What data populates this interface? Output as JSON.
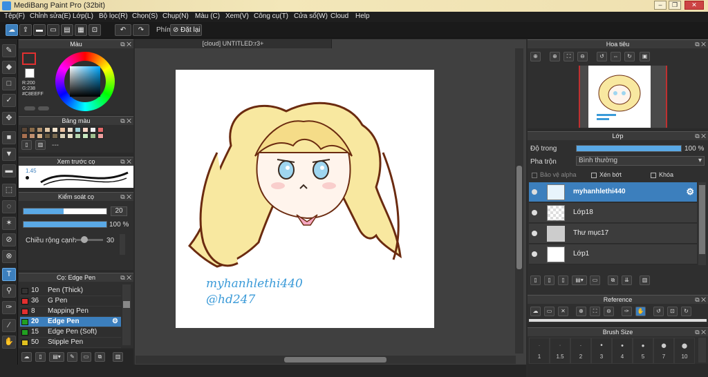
{
  "window": {
    "title": "MediBang Paint Pro (32bit)"
  },
  "menu": [
    "Tệp(F)",
    "Chỉnh sửa(E)",
    "Lớp(L)",
    "Bộ lọc(R)",
    "Chọn(S)",
    "Chụp(N)",
    "Màu (C)",
    "Xem(V)",
    "Công cụ(T)",
    "Cửa sổ(W)",
    "Cloud",
    "Help"
  ],
  "toolbar": {
    "shortcut_label": "Phím",
    "reset_label": "Đặt lại"
  },
  "color_panel": {
    "title": "Màu",
    "r": "R:200",
    "g": "G:238",
    "hex": "#C8EEFF",
    "primary": "#C8EEFF",
    "secondary": "#FFFFFF"
  },
  "palette_panel": {
    "title": "Bảng màu",
    "dash": "---",
    "colors": [
      "#5a4636",
      "#8a6b4a",
      "#b0906c",
      "#e0c7a6",
      "#f3e3cd",
      "#e8c0a0",
      "#e8dccc",
      "#9ed0d8",
      "#f6d6c6",
      "#f0f0f0",
      "#e46a6a",
      "#a87050",
      "#c09070",
      "#d4b088",
      "#6a5a40",
      "#7a6a50",
      "#d8d0b8",
      "#e8e0c8",
      "#b4d4ae",
      "#c8e8c0",
      "#a0c090",
      "#f0a0a0"
    ]
  },
  "brush_preview": {
    "title": "Xem trước cọ",
    "size": "1.45"
  },
  "brush_control": {
    "title": "Kiểm soát cọ",
    "size_value": "20",
    "size_level": 0.48,
    "opacity_value": "100 %",
    "opacity_level": 1.0,
    "edge_width_label": "Chiều rộng cạnh",
    "edge_width_value": "30"
  },
  "brush_list": {
    "title": "Cọ: Edge Pen",
    "items": [
      {
        "num": "10",
        "name": "Pen (Thick)",
        "color": "#333333"
      },
      {
        "num": "36",
        "name": "G Pen",
        "color": "#e23030"
      },
      {
        "num": "8",
        "name": "Mapping Pen",
        "color": "#e23030"
      },
      {
        "num": "20",
        "name": "Edge Pen",
        "color": "#22a022"
      },
      {
        "num": "15",
        "name": "Edge Pen (Soft)",
        "color": "#22a022"
      },
      {
        "num": "50",
        "name": "Stipple Pen",
        "color": "#e0c020"
      }
    ]
  },
  "document": {
    "tab": "[cloud] UNTITLED:r3+",
    "signature_line1": "myhanhlethi440",
    "signature_line2": "@hd247"
  },
  "navigator": {
    "title": "Hoa tiêu"
  },
  "layers_panel": {
    "title": "Lớp",
    "opacity_label": "Độ trong",
    "opacity_value": "100 %",
    "opacity_level": 1.0,
    "blend_label": "Pha trộn",
    "blend_value": "Bình thường",
    "protect_alpha": "Bảo vệ alpha",
    "clipping": "Xén bớt",
    "lock": "Khóa",
    "layers": [
      {
        "name": "myhanhlethi440"
      },
      {
        "name": "Lớp18"
      },
      {
        "name": "Thư mục17"
      },
      {
        "name": "Lớp1"
      }
    ]
  },
  "reference_panel": {
    "title": "Reference"
  },
  "brush_size_panel": {
    "title": "Brush Size",
    "sizes": [
      "1",
      "1.5",
      "2",
      "3",
      "4",
      "5",
      "7",
      "10"
    ]
  }
}
